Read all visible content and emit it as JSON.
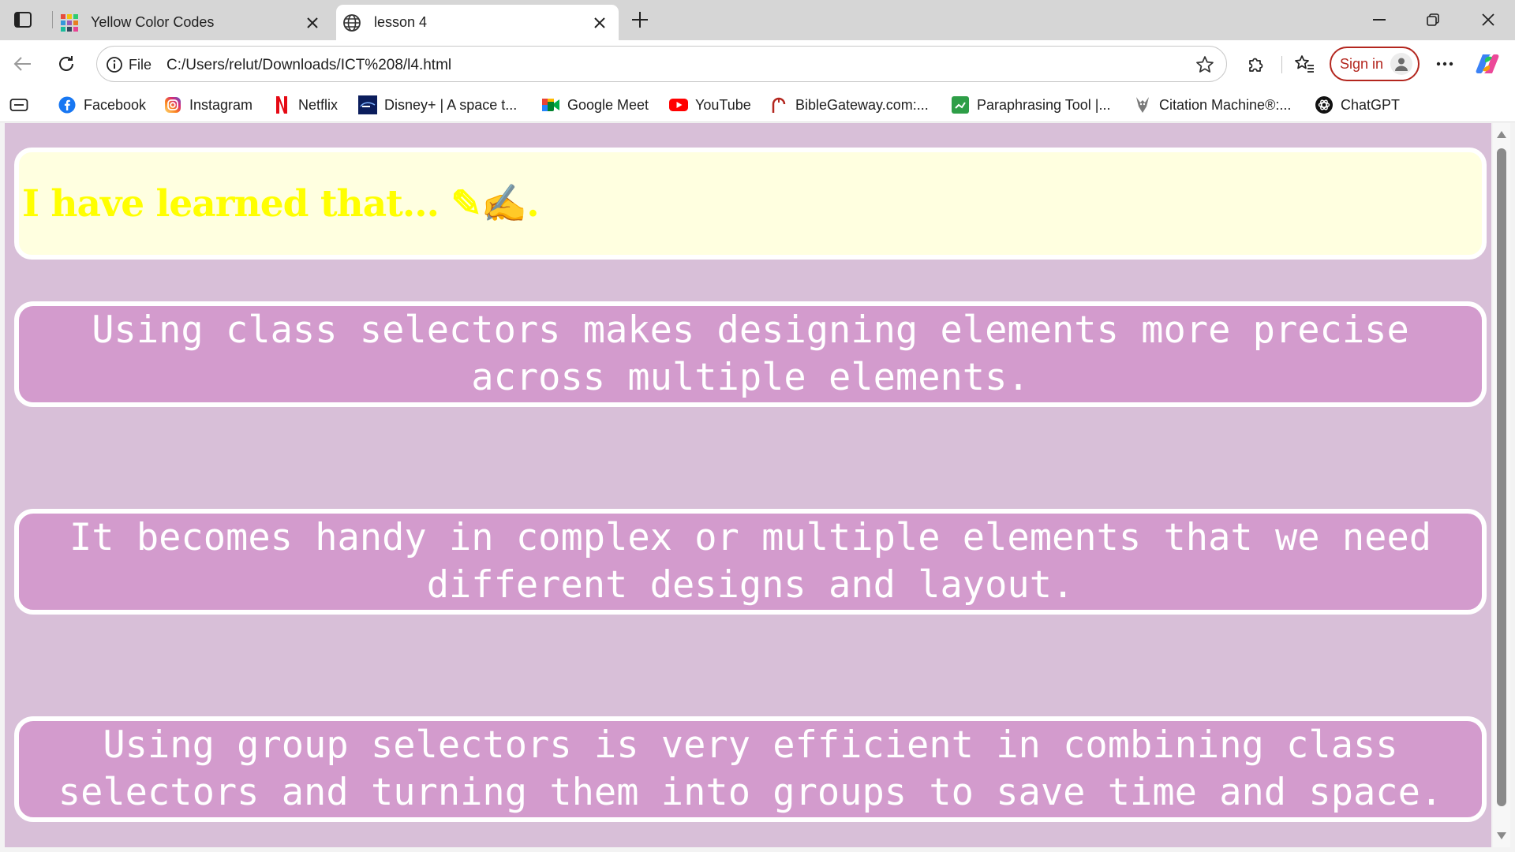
{
  "tabs": [
    {
      "title": "Yellow Color Codes",
      "favicon": "color-grid-icon",
      "active": false
    },
    {
      "title": "lesson 4",
      "favicon": "globe-icon",
      "active": true
    }
  ],
  "toolbar": {
    "scheme_label": "File",
    "url": "C:/Users/relut/Downloads/ICT%208/l4.html",
    "sign_in_label": "Sign in"
  },
  "bookmarks": [
    {
      "label": "Facebook",
      "icon": "facebook-icon",
      "color": "#1877f2"
    },
    {
      "label": "Instagram",
      "icon": "instagram-icon",
      "color": "#d6249f"
    },
    {
      "label": "Netflix",
      "icon": "netflix-icon",
      "color": "#e50914"
    },
    {
      "label": "Disney+ | A space t...",
      "icon": "disney-plus-icon",
      "color": "#0b1d5c"
    },
    {
      "label": "Google Meet",
      "icon": "google-meet-icon",
      "color": "#00832d"
    },
    {
      "label": "YouTube",
      "icon": "youtube-icon",
      "color": "#ff0000"
    },
    {
      "label": "BibleGateway.com:...",
      "icon": "biblegateway-icon",
      "color": "#b3261e"
    },
    {
      "label": "Paraphrasing Tool |...",
      "icon": "paraphrasing-tool-icon",
      "color": "#2e9e47"
    },
    {
      "label": "Citation Machine®:...",
      "icon": "citation-machine-icon",
      "color": "#6b6b6b"
    },
    {
      "label": "ChatGPT",
      "icon": "chatgpt-icon",
      "color": "#000000"
    }
  ],
  "page": {
    "heading": "I have learned that... ✎✍.",
    "paragraphs": [
      "Using class selectors makes designing elements more precise across multiple elements.",
      "It becomes handy in complex or multiple elements that we need different designs and layout.",
      "Using group selectors is very efficient in combining class selectors and turning them into groups to save time and space."
    ]
  },
  "colors": {
    "page_background": "#d8bfd8",
    "heading_box": "#ffffe0",
    "heading_text": "#ffff00",
    "text_box": "#d39bcd",
    "text_color": "#ffffff",
    "border": "#ffffff"
  }
}
